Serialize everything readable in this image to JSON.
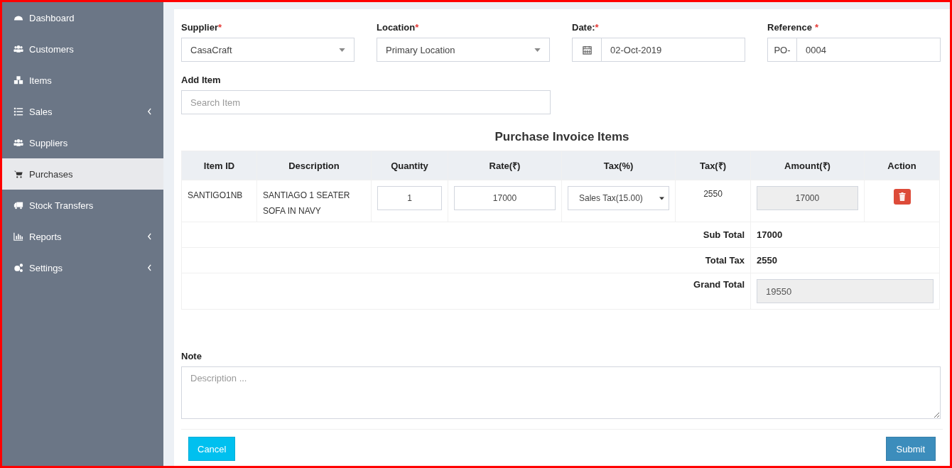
{
  "sidebar": {
    "items": [
      {
        "label": "Dashboard",
        "selected": false,
        "has_submenu": false
      },
      {
        "label": "Customers",
        "selected": false,
        "has_submenu": false
      },
      {
        "label": "Items",
        "selected": false,
        "has_submenu": false
      },
      {
        "label": "Sales",
        "selected": false,
        "has_submenu": true
      },
      {
        "label": "Suppliers",
        "selected": false,
        "has_submenu": false
      },
      {
        "label": "Purchases",
        "selected": true,
        "has_submenu": false
      },
      {
        "label": "Stock Transfers",
        "selected": false,
        "has_submenu": false
      },
      {
        "label": "Reports",
        "selected": false,
        "has_submenu": true
      },
      {
        "label": "Settings",
        "selected": false,
        "has_submenu": true
      }
    ]
  },
  "form": {
    "supplier": {
      "label": "Supplier",
      "required_mark": "*",
      "value": "CasaCraft"
    },
    "location": {
      "label": "Location",
      "required_mark": "*",
      "value": "Primary Location"
    },
    "date": {
      "label": "Date:",
      "required_mark": "*",
      "value": "02-Oct-2019"
    },
    "reference": {
      "label": "Reference",
      "required_mark": "*",
      "prefix": "PO-",
      "value": "0004"
    },
    "add_item": {
      "label": "Add Item",
      "placeholder": "Search Item"
    }
  },
  "items_table": {
    "title": "Purchase Invoice Items",
    "columns": [
      "Item ID",
      "Description",
      "Quantity",
      "Rate(₹)",
      "Tax(%)",
      "Tax(₹)",
      "Amount(₹)",
      "Action"
    ],
    "rows": [
      {
        "item_id": "SANTIGO1NB",
        "description": "SANTIAGO 1 SEATER SOFA IN NAVY",
        "quantity": "1",
        "rate": "17000",
        "tax_type": "Sales Tax(15.00)",
        "tax_amount": "2550",
        "amount": "17000"
      }
    ],
    "sub_total": {
      "label": "Sub Total",
      "value": "17000"
    },
    "total_tax": {
      "label": "Total Tax",
      "value": "2550"
    },
    "grand_total": {
      "label": "Grand Total",
      "value": "19550"
    }
  },
  "note": {
    "label": "Note",
    "placeholder": "Description ..."
  },
  "buttons": {
    "cancel": "Cancel",
    "submit": "Submit"
  }
}
